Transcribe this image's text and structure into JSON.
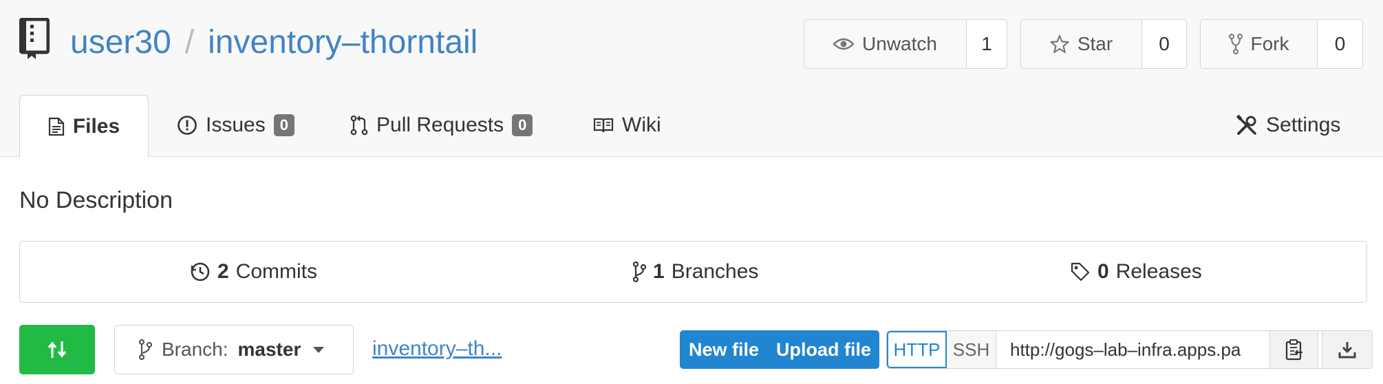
{
  "repo": {
    "owner": "user30",
    "separator": "/",
    "name": "inventory–thorntail",
    "description": "No Description"
  },
  "actions": {
    "watch": {
      "label": "Unwatch",
      "count": "1",
      "icon": "eye-icon"
    },
    "star": {
      "label": "Star",
      "count": "0",
      "icon": "star-icon"
    },
    "fork": {
      "label": "Fork",
      "count": "0",
      "icon": "fork-icon"
    }
  },
  "tabs": {
    "files": {
      "label": "Files",
      "icon": "file-text-icon"
    },
    "issues": {
      "label": "Issues",
      "count": "0",
      "icon": "issue-icon"
    },
    "pulls": {
      "label": "Pull Requests",
      "count": "0",
      "icon": "pull-request-icon"
    },
    "wiki": {
      "label": "Wiki",
      "icon": "book-icon"
    },
    "settings": {
      "label": "Settings",
      "icon": "tools-icon"
    }
  },
  "stats": {
    "commits": {
      "count": "2",
      "label": "Commits"
    },
    "branches": {
      "count": "1",
      "label": "Branches"
    },
    "releases": {
      "count": "0",
      "label": "Releases"
    }
  },
  "toolbar": {
    "branch_prefix": "Branch:",
    "branch_name": "master",
    "breadcrumb": "inventory–th...",
    "new_file": "New file",
    "upload_file": "Upload file",
    "clone_http": "HTTP",
    "clone_ssh": "SSH",
    "clone_url": "http://gogs–lab–infra.apps.pa"
  },
  "colors": {
    "link": "#4183c4",
    "primary": "#2185d0",
    "success": "#21ba45",
    "badge": "#767676"
  }
}
